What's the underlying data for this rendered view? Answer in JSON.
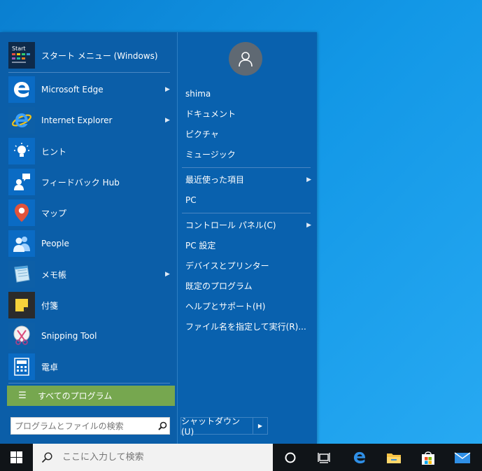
{
  "start_menu": {
    "header": {
      "label": "スタート メニュー (Windows)",
      "logo_text": "Start"
    },
    "apps": [
      {
        "label": "Microsoft Edge",
        "icon": "edge-icon",
        "has_submenu": true
      },
      {
        "label": "Internet Explorer",
        "icon": "internet-explorer-icon",
        "has_submenu": true
      },
      {
        "label": "ヒント",
        "icon": "lightbulb-icon",
        "has_submenu": false
      },
      {
        "label": "フィードバック Hub",
        "icon": "feedback-hub-icon",
        "has_submenu": false
      },
      {
        "label": "マップ",
        "icon": "map-pin-icon",
        "has_submenu": false
      },
      {
        "label": "People",
        "icon": "people-icon",
        "has_submenu": false
      },
      {
        "label": "メモ帳",
        "icon": "notepad-icon",
        "has_submenu": true
      },
      {
        "label": "付箋",
        "icon": "sticky-notes-icon",
        "has_submenu": false
      },
      {
        "label": "Snipping Tool",
        "icon": "scissors-icon",
        "has_submenu": false
      },
      {
        "label": "電卓",
        "icon": "calculator-icon",
        "has_submenu": false
      }
    ],
    "all_programs_label": "すべてのプログラム",
    "search": {
      "placeholder": "プログラムとファイルの検索"
    },
    "right": {
      "user_name": "shima",
      "group1": [
        "ドキュメント",
        "ピクチャ",
        "ミュージック"
      ],
      "group2": [
        {
          "label": "最近使った項目",
          "has_submenu": true
        },
        {
          "label": "PC",
          "has_submenu": false
        }
      ],
      "group3": [
        {
          "label": "コントロール パネル(C)",
          "has_submenu": true
        },
        {
          "label": "PC 設定",
          "has_submenu": false
        },
        {
          "label": "デバイスとプリンター",
          "has_submenu": false
        },
        {
          "label": "既定のプログラム",
          "has_submenu": false
        },
        {
          "label": "ヘルプとサポート(H)",
          "has_submenu": false
        },
        {
          "label": "ファイル名を指定して実行(R)...",
          "has_submenu": false
        }
      ],
      "shutdown_label": "シャットダウン(U)"
    }
  },
  "taskbar": {
    "search_placeholder": "ここに入力して検索",
    "pinned": [
      "cortana-icon",
      "task-view-icon",
      "edge-icon",
      "file-explorer-icon",
      "store-icon",
      "mail-icon"
    ]
  },
  "colors": {
    "menu_bg": "#0b5ea8",
    "all_programs_bg": "#76a74f",
    "taskbar_bg": "#101418"
  }
}
